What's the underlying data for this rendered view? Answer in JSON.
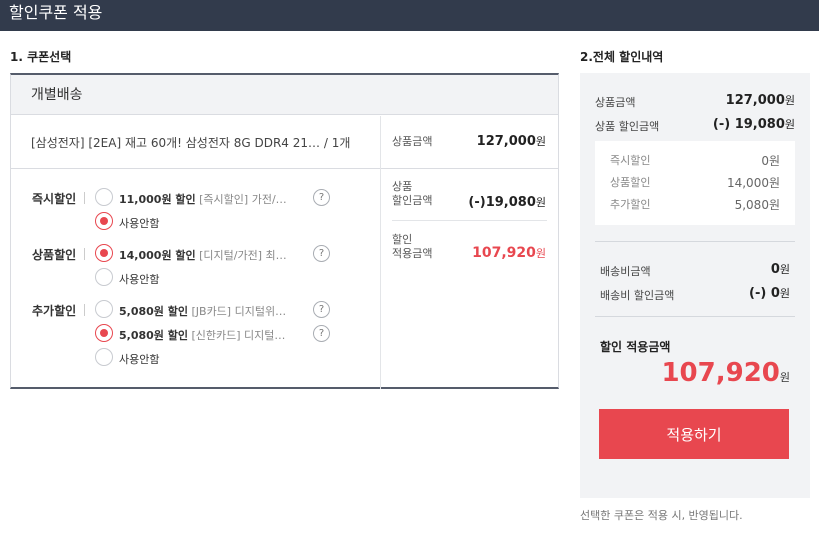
{
  "window": {
    "title": "할인쿠폰 적용"
  },
  "left": {
    "section_title": "1. 쿠폰선택",
    "header": "개별배송",
    "product": {
      "name": "[삼성전자] [2EA] 재고 60개! 삼성전자 8G DDR4 21… / 1개",
      "price_label": "상품금액",
      "price_value": "127,000",
      "discount_label_1": "상품",
      "discount_label_2": "할인금액",
      "discount_value": "(-)19,080",
      "applied_label_1": "할인",
      "applied_label_2": "적용금액",
      "applied_value": "107,920",
      "won": "원"
    },
    "categories": [
      {
        "label": "즉시할인",
        "options": [
          {
            "amount": "11,000원 할인",
            "desc": "[즉시할인] 가전/…",
            "selected": false,
            "help": "?"
          },
          {
            "amount": "",
            "desc": "사용안함",
            "selected": true
          }
        ]
      },
      {
        "label": "상품할인",
        "options": [
          {
            "amount": "14,000원 할인",
            "desc": "[디지털/가전] 최…",
            "selected": true,
            "help": "?"
          },
          {
            "amount": "",
            "desc": "사용안함",
            "selected": false
          }
        ]
      },
      {
        "label": "추가할인",
        "options": [
          {
            "amount": "5,080원 할인",
            "desc": "[JB카드] 디지털위…",
            "selected": false,
            "help": "?"
          },
          {
            "amount": "5,080원 할인",
            "desc": "[신한카드] 디지털…",
            "selected": true,
            "help": "?"
          },
          {
            "amount": "",
            "desc": "사용안함",
            "selected": false
          }
        ]
      }
    ]
  },
  "right": {
    "section_title": "2.전체 할인내역",
    "product_amount_label": "상품금액",
    "product_amount_value": "127,000",
    "product_discount_label": "상품 할인금액",
    "product_discount_value": "(-) 19,080",
    "breakdown": [
      {
        "label": "즉시할인",
        "value": "0원"
      },
      {
        "label": "상품할인",
        "value": "14,000원"
      },
      {
        "label": "추가할인",
        "value": "5,080원"
      }
    ],
    "shipping_label": "배송비금액",
    "shipping_value": "0",
    "shipping_discount_label": "배송비 할인금액",
    "shipping_discount_value": "(-) 0",
    "final_label": "할인 적용금액",
    "final_value": "107,920",
    "won": "원",
    "apply_button": "적용하기",
    "footnote": "선택한 쿠폰은 적용 시, 반영됩니다."
  },
  "colors": {
    "titlebar": "#323b4c",
    "accent": "#e8474f",
    "panel_bg": "#f2f3f5"
  }
}
